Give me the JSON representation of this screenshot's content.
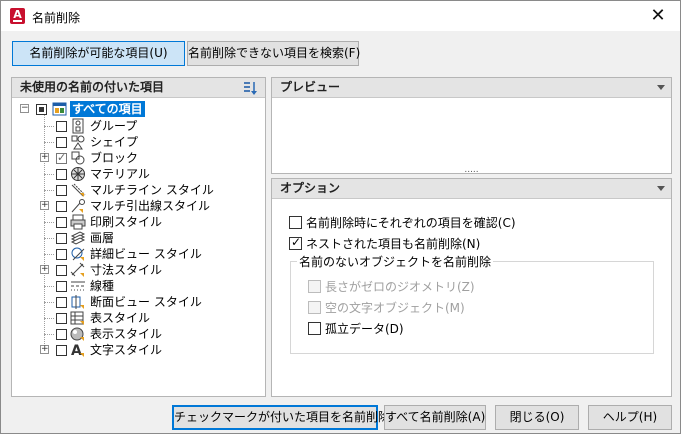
{
  "window": {
    "title": "名前削除",
    "app_icon_letter": "A"
  },
  "top_buttons": {
    "purgeable": "名前削除が可能な項目(U)",
    "find_non_purgeable": "名前削除できない項目を検索(F)"
  },
  "tree_panel": {
    "header": "未使用の名前の付いた項目",
    "root": "すべての項目",
    "items": [
      {
        "label": "グループ",
        "icon": "group-icon",
        "expandable": false,
        "checked": false
      },
      {
        "label": "シェイプ",
        "icon": "shape-icon",
        "expandable": false,
        "checked": false
      },
      {
        "label": "ブロック",
        "icon": "block-icon",
        "expandable": true,
        "checked": true
      },
      {
        "label": "マテリアル",
        "icon": "material-icon",
        "expandable": false,
        "checked": false
      },
      {
        "label": "マルチライン スタイル",
        "icon": "multiline-style-icon",
        "expandable": false,
        "checked": false
      },
      {
        "label": "マルチ引出線スタイル",
        "icon": "multileader-style-icon",
        "expandable": true,
        "checked": false
      },
      {
        "label": "印刷スタイル",
        "icon": "plot-style-icon",
        "expandable": false,
        "checked": false
      },
      {
        "label": "画層",
        "icon": "layer-icon",
        "expandable": false,
        "checked": false
      },
      {
        "label": "詳細ビュー スタイル",
        "icon": "detail-view-style-icon",
        "expandable": false,
        "checked": false
      },
      {
        "label": "寸法スタイル",
        "icon": "dimension-style-icon",
        "expandable": true,
        "checked": false
      },
      {
        "label": "線種",
        "icon": "linetype-icon",
        "expandable": false,
        "checked": false
      },
      {
        "label": "断面ビュー スタイル",
        "icon": "section-view-style-icon",
        "expandable": false,
        "checked": false
      },
      {
        "label": "表スタイル",
        "icon": "table-style-icon",
        "expandable": false,
        "checked": false
      },
      {
        "label": "表示スタイル",
        "icon": "visual-style-icon",
        "expandable": false,
        "checked": false
      },
      {
        "label": "文字スタイル",
        "icon": "text-style-icon",
        "expandable": true,
        "checked": false
      }
    ]
  },
  "preview_panel": {
    "header": "プレビュー",
    "splitter": "....."
  },
  "options_panel": {
    "header": "オプション",
    "confirm_each": {
      "label": "名前削除時にそれぞれの項目を確認(C)",
      "checked": false
    },
    "nested": {
      "label": "ネストされた項目も名前削除(N)",
      "checked": true
    },
    "group_title": "名前のないオブジェクトを名前削除",
    "zero_length": {
      "label": "長さがゼロのジオメトリ(Z)",
      "checked": false,
      "enabled": false
    },
    "empty_text": {
      "label": "空の文字オブジェクト(M)",
      "checked": false,
      "enabled": false
    },
    "orphaned": {
      "label": "孤立データ(D)",
      "checked": false,
      "enabled": true
    }
  },
  "bottom_buttons": {
    "purge_checked": "チェックマークが付いた項目を名前削除(P)",
    "purge_all": "すべて名前削除(A)",
    "close": "閉じる(O)",
    "help": "ヘルプ(H)"
  }
}
